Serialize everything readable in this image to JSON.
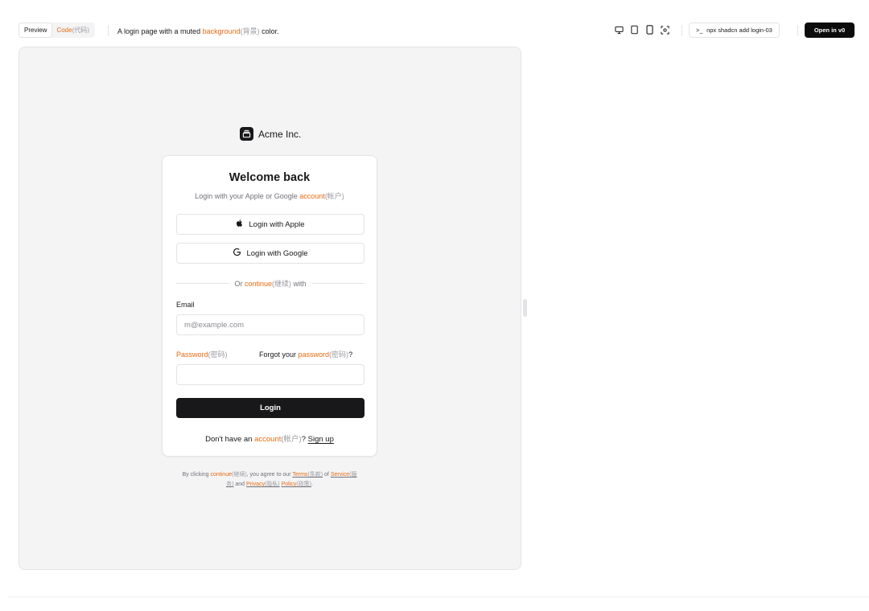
{
  "toolbar": {
    "tab_preview": "Preview",
    "tab_code": "Code",
    "tab_code_cn": "(代码)",
    "description_pre": "A login page with a muted ",
    "description_hl": "background",
    "description_cn": "(背景)",
    "description_post": " color.",
    "command_prompt": ">_",
    "command": "npx shadcn add login-03",
    "open_in": "Open in v0"
  },
  "login": {
    "brand": "Acme Inc.",
    "title": "Welcome back",
    "subtitle_pre": "Login with your Apple or Google ",
    "subtitle_hl": "account",
    "subtitle_cn": "(帐户)",
    "apple_button": "Login with Apple",
    "google_button": "Login with Google",
    "divider_pre": "Or ",
    "divider_hl": "continue",
    "divider_cn": "(继续)",
    "divider_post": " with",
    "email_label": "Email",
    "email_placeholder": "m@example.com",
    "password_label": "Password",
    "password_label_cn": "(密码)",
    "forgot_pre": "Forgot your ",
    "forgot_hl": "password",
    "forgot_cn": "(密码)",
    "forgot_post": "?",
    "password_value": "",
    "login_button": "Login",
    "signup_pre": "Don't have an ",
    "signup_hl": "account",
    "signup_cn": "(帐户)",
    "signup_q": "? ",
    "signup_link": "Sign up"
  },
  "terms": {
    "t1": "By clicking ",
    "continue": "continue",
    "continue_cn": "(继续)",
    "t2": ", you agree to our ",
    "terms": "Terms",
    "terms_cn": "(条款)",
    "t3": " of ",
    "service": "Service",
    "service_cn": "(服务)",
    "t4": " and ",
    "privacy": "Privacy",
    "privacy_cn": "(隐私)",
    "t5": " ",
    "policy": "Policy",
    "policy_cn": "(政策)",
    "t6": "."
  },
  "colors": {
    "accent": "#ea6a12",
    "primary": "#18181b",
    "muted_bg": "#f4f4f4"
  }
}
